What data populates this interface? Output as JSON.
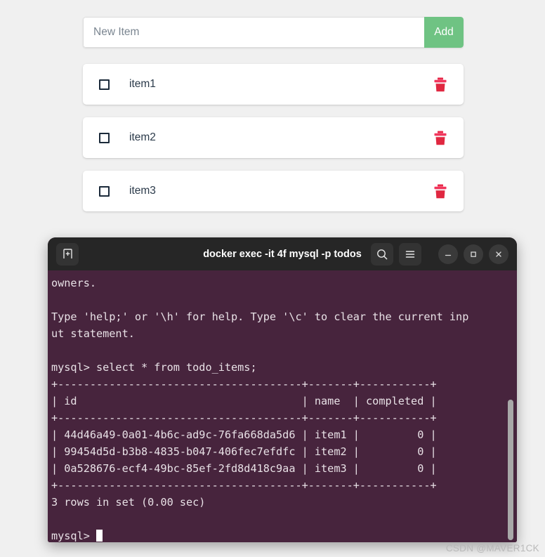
{
  "page": {
    "background": "#f0f0f0",
    "watermark": "CSDN @MAVER1CK"
  },
  "todo_app": {
    "input": {
      "placeholder": "New Item",
      "value": ""
    },
    "add_button": {
      "label": "Add",
      "color": "#6fc383"
    },
    "items": [
      {
        "label": "item1",
        "checked": false,
        "delete_icon": "trash-icon"
      },
      {
        "label": "item2",
        "checked": false,
        "delete_icon": "trash-icon"
      },
      {
        "label": "item3",
        "checked": false,
        "delete_icon": "trash-icon"
      }
    ]
  },
  "terminal": {
    "title": "docker exec -it 4f mysql -p todos",
    "title_bar_icons": {
      "new_tab": "new-tab-icon",
      "search": "search-icon",
      "menu": "hamburger-menu-icon",
      "minimize": "minimize-icon",
      "maximize": "maximize-icon",
      "close": "close-icon"
    },
    "background": "#47243d",
    "lines": [
      "owners.",
      "",
      "Type 'help;' or '\\h' for help. Type '\\c' to clear the current inp",
      "ut statement.",
      "",
      "mysql> select * from todo_items;",
      "+--------------------------------------+-------+-----------+",
      "| id                                   | name  | completed |",
      "+--------------------------------------+-------+-----------+",
      "| 44d46a49-0a01-4b6c-ad9c-76fa668da5d6 | item1 |         0 |",
      "| 99454d5d-b3b8-4835-b047-406fec7efdfc | item2 |         0 |",
      "| 0a528676-ecf4-49bc-85ef-2fd8d418c9aa | item3 |         0 |",
      "+--------------------------------------+-------+-----------+",
      "3 rows in set (0.00 sec)",
      "",
      "mysql> "
    ],
    "query": "select * from todo_items;",
    "prompt": "mysql> ",
    "result_summary": "3 rows in set (0.00 sec)",
    "table": {
      "columns": [
        "id",
        "name",
        "completed"
      ],
      "rows": [
        [
          "44d46a49-0a01-4b6c-ad9c-76fa668da5d6",
          "item1",
          "0"
        ],
        [
          "99454d5d-b3b8-4835-b047-406fec7efdfc",
          "item2",
          "0"
        ],
        [
          "0a528676-ecf4-49bc-85ef-2fd8d418c9aa",
          "item3",
          "0"
        ]
      ]
    }
  }
}
